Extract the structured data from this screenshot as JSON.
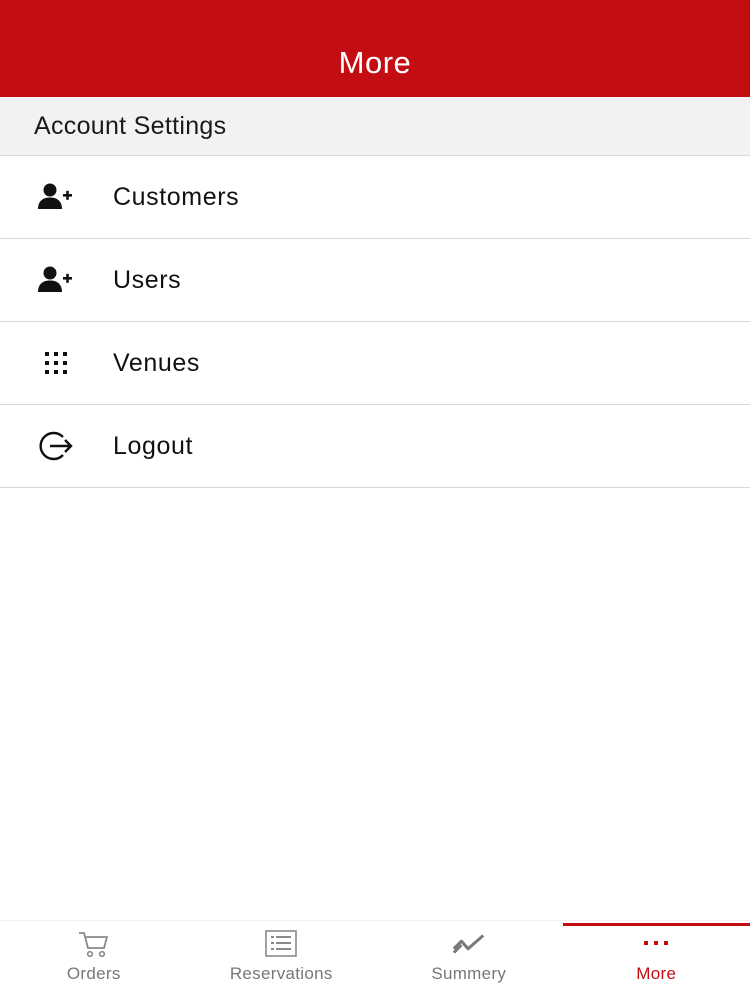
{
  "header": {
    "title": "More"
  },
  "section": {
    "label": "Account Settings"
  },
  "menu": {
    "items": [
      {
        "label": "Customers",
        "icon": "add-user-icon"
      },
      {
        "label": "Users",
        "icon": "add-user-icon"
      },
      {
        "label": "Venues",
        "icon": "grid-icon"
      },
      {
        "label": "Logout",
        "icon": "logout-icon"
      }
    ]
  },
  "tabs": [
    {
      "label": "Orders",
      "icon": "cart-icon",
      "active": false
    },
    {
      "label": "Reservations",
      "icon": "list-icon",
      "active": false
    },
    {
      "label": "Summery",
      "icon": "trend-icon",
      "active": false
    },
    {
      "label": "More",
      "icon": "more-dots-icon",
      "active": true
    }
  ],
  "colors": {
    "accent": "#c40d12",
    "inactive": "#777777",
    "section_bg": "#f2f2f4"
  }
}
